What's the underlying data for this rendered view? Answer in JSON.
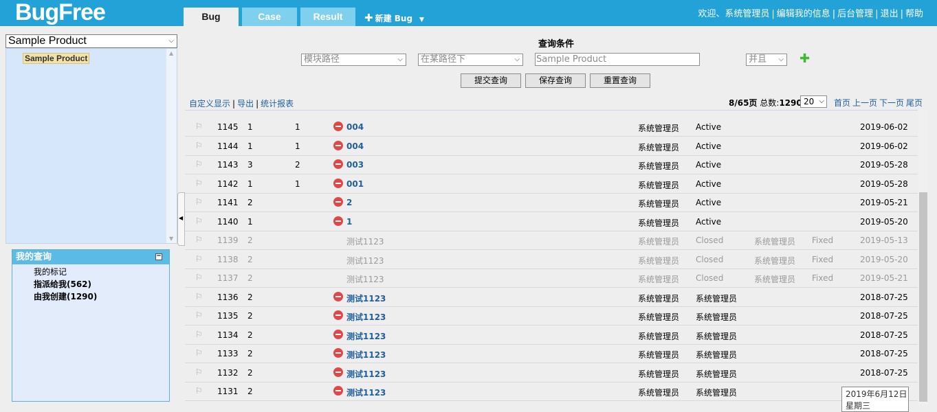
{
  "header": {
    "logo": "BugFree",
    "tabs": [
      "Bug",
      "Case",
      "Result"
    ],
    "new_bug": "新建 Bug",
    "links": [
      "欢迎、系统管理员",
      "编辑我的信息",
      "后台管理",
      "退出",
      "帮助"
    ]
  },
  "sidebar": {
    "product_select": "Sample Product",
    "tree_node": "Sample Product",
    "my_query_title": "我的查询",
    "my_query_items": [
      "我的标记",
      "指派给我(562)",
      "由我创建(1290)"
    ]
  },
  "query": {
    "title": "查询条件",
    "field": "模块路径",
    "operator": "在某路径下",
    "value_placeholder": "Sample Product",
    "logic": "并且",
    "buttons": [
      "提交查询",
      "保存查询",
      "重置查询"
    ]
  },
  "toolbar": {
    "links": [
      "自定义显示",
      "导出",
      "统计报表"
    ],
    "page_info": "8/65页",
    "total_label": "总数:",
    "total": "1290",
    "page_size": "20",
    "pager": [
      "首页",
      "上一页",
      "下一页",
      "尾页"
    ]
  },
  "rows": [
    {
      "id": "1145",
      "sev": "1",
      "pri": "1",
      "title": "004",
      "by": "系统管理员",
      "status": "Active",
      "resby": "",
      "res": "",
      "date": "2019-06-02",
      "closed": false
    },
    {
      "id": "1144",
      "sev": "1",
      "pri": "1",
      "title": "004",
      "by": "系统管理员",
      "status": "Active",
      "resby": "",
      "res": "",
      "date": "2019-06-02",
      "closed": false
    },
    {
      "id": "1143",
      "sev": "3",
      "pri": "2",
      "title": "003",
      "by": "系统管理员",
      "status": "Active",
      "resby": "",
      "res": "",
      "date": "2019-05-28",
      "closed": false
    },
    {
      "id": "1142",
      "sev": "1",
      "pri": "1",
      "title": "001",
      "by": "系统管理员",
      "status": "Active",
      "resby": "",
      "res": "",
      "date": "2019-05-28",
      "closed": false
    },
    {
      "id": "1141",
      "sev": "2",
      "pri": "",
      "title": "2",
      "by": "系统管理员",
      "status": "Active",
      "resby": "",
      "res": "",
      "date": "2019-05-21",
      "closed": false
    },
    {
      "id": "1140",
      "sev": "1",
      "pri": "",
      "title": "1",
      "by": "系统管理员",
      "status": "Active",
      "resby": "",
      "res": "",
      "date": "2019-05-20",
      "closed": false
    },
    {
      "id": "1139",
      "sev": "2",
      "pri": "",
      "title": "测试1123",
      "by": "系统管理员",
      "status": "Closed",
      "resby": "系统管理员",
      "res": "Fixed",
      "date": "2019-05-13",
      "closed": true
    },
    {
      "id": "1138",
      "sev": "2",
      "pri": "",
      "title": "测试1123",
      "by": "系统管理员",
      "status": "Closed",
      "resby": "系统管理员",
      "res": "Fixed",
      "date": "2019-05-20",
      "closed": true
    },
    {
      "id": "1137",
      "sev": "2",
      "pri": "",
      "title": "测试1123",
      "by": "系统管理员",
      "status": "Closed",
      "resby": "系统管理员",
      "res": "Fixed",
      "date": "2019-05-21",
      "closed": true
    },
    {
      "id": "1136",
      "sev": "2",
      "pri": "",
      "title": "测试1123",
      "by": "系统管理员",
      "status": "系统管理员",
      "resby": "",
      "res": "",
      "date": "2018-07-25",
      "closed": false
    },
    {
      "id": "1135",
      "sev": "2",
      "pri": "",
      "title": "测试1123",
      "by": "系统管理员",
      "status": "系统管理员",
      "resby": "",
      "res": "",
      "date": "2018-07-25",
      "closed": false
    },
    {
      "id": "1134",
      "sev": "2",
      "pri": "",
      "title": "测试1123",
      "by": "系统管理员",
      "status": "系统管理员",
      "resby": "",
      "res": "",
      "date": "2018-07-25",
      "closed": false
    },
    {
      "id": "1133",
      "sev": "2",
      "pri": "",
      "title": "测试1123",
      "by": "系统管理员",
      "status": "系统管理员",
      "resby": "",
      "res": "",
      "date": "2018-07-25",
      "closed": false
    },
    {
      "id": "1132",
      "sev": "2",
      "pri": "",
      "title": "测试1123",
      "by": "系统管理员",
      "status": "系统管理员",
      "resby": "",
      "res": "",
      "date": "2018-07-25",
      "closed": false
    },
    {
      "id": "1131",
      "sev": "2",
      "pri": "",
      "title": "测试1123",
      "by": "系统管理员",
      "status": "系统管理员",
      "resby": "",
      "res": "",
      "date": "",
      "closed": false
    }
  ],
  "tooltip": {
    "date": "2019年6月12日",
    "weekday": "星期三"
  }
}
